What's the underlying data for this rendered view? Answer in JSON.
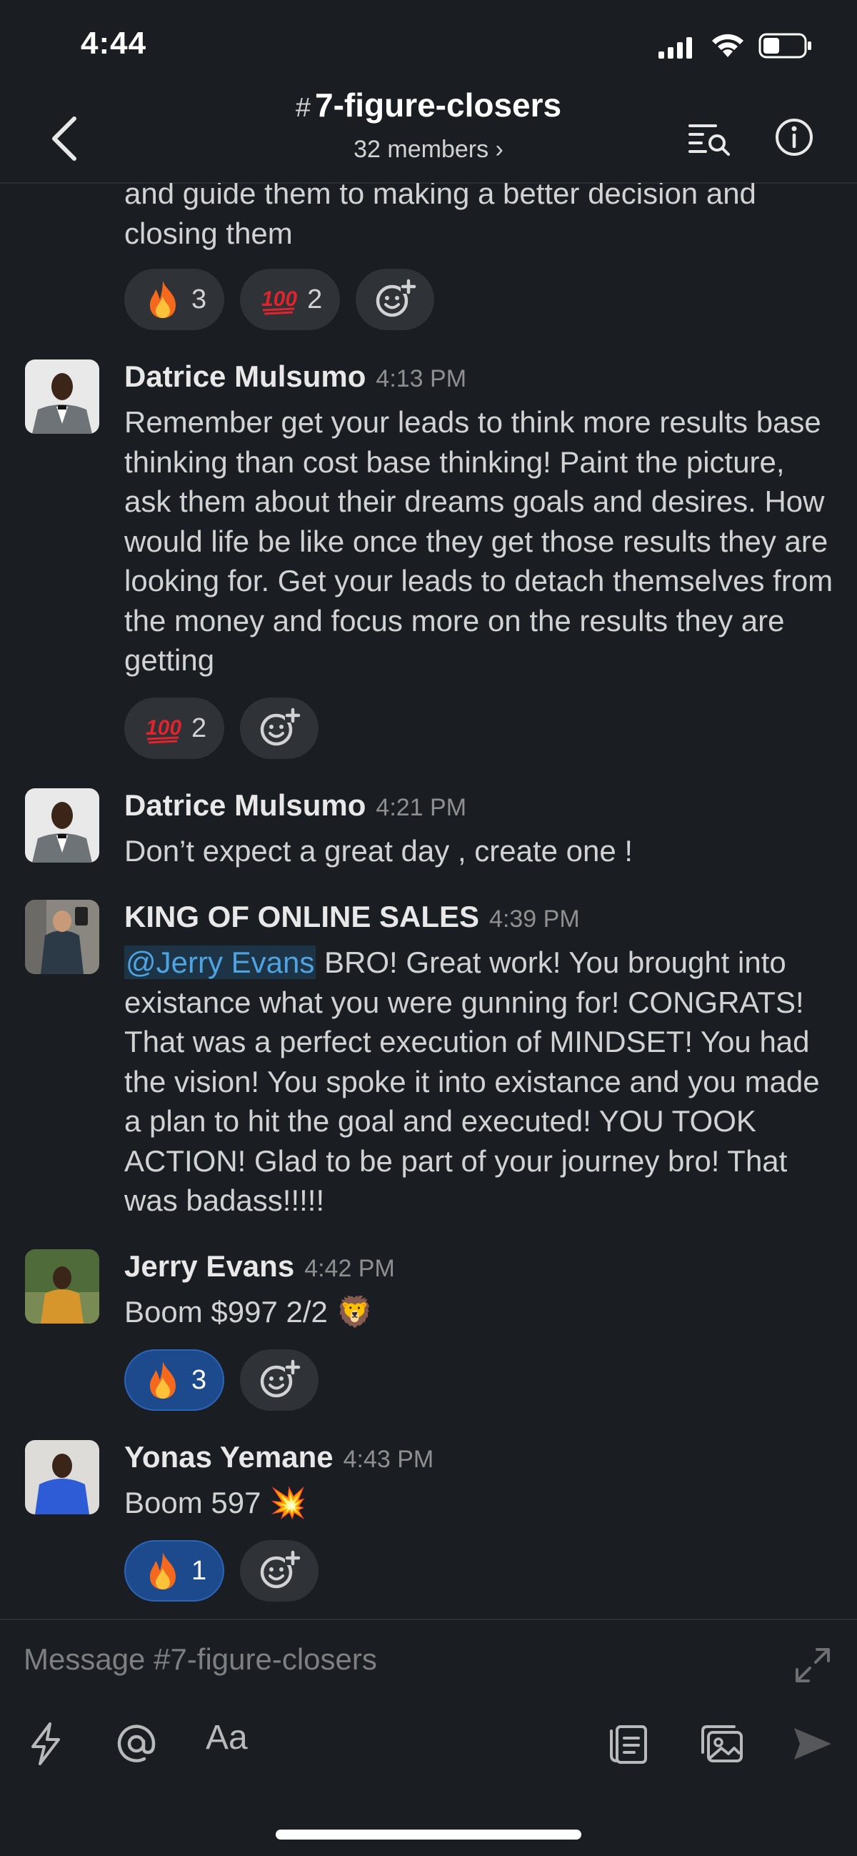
{
  "status_bar": {
    "time": "4:44"
  },
  "header": {
    "hash": "#",
    "channel_name": "7-figure-closers",
    "members": "32 members ›"
  },
  "messages": [
    {
      "continuation_text": "and guide them to making a better decision and closing them",
      "reactions": [
        {
          "emoji": "fire",
          "count": "3",
          "active": false
        },
        {
          "emoji": "100",
          "count": "2",
          "active": false
        }
      ]
    },
    {
      "author": "Datrice Mulsumo",
      "time": "4:13 PM",
      "text": "Remember get your leads to think more results base thinking than cost base thinking! Paint the picture, ask them about their dreams goals and desires. How would life be like once they get those results they are looking for. Get your leads to detach themselves from the money and focus more on the results they are getting",
      "reactions": [
        {
          "emoji": "100",
          "count": "2",
          "active": false
        }
      ]
    },
    {
      "author": "Datrice Mulsumo",
      "time": "4:21 PM",
      "text": "Don’t expect a great day , create one !"
    },
    {
      "author": "KING OF ONLINE SALES",
      "time": "4:39 PM",
      "mention": "@Jerry Evans",
      "text": " BRO!  Great work!   You brought into existance what you were gunning for!  CONGRATS!  That was a perfect execution of MINDSET!  You had the vision!  You spoke it into existance and you made a plan to hit the goal and executed!  YOU TOOK ACTION!  Glad to be part of your journey bro!  That was badass!!!!!"
    },
    {
      "author": "Jerry Evans",
      "time": "4:42 PM",
      "text": "Boom $997 2/2 ",
      "emoji": "🦁",
      "reactions": [
        {
          "emoji": "fire",
          "count": "3",
          "active": true
        }
      ]
    },
    {
      "author": "Yonas Yemane",
      "time": "4:43 PM",
      "text": "Boom 597 ",
      "emoji": "💥",
      "reactions": [
        {
          "emoji": "fire",
          "count": "1",
          "active": true
        }
      ]
    }
  ],
  "composer": {
    "placeholder": "Message #7-figure-closers",
    "format_label": "Aa"
  }
}
